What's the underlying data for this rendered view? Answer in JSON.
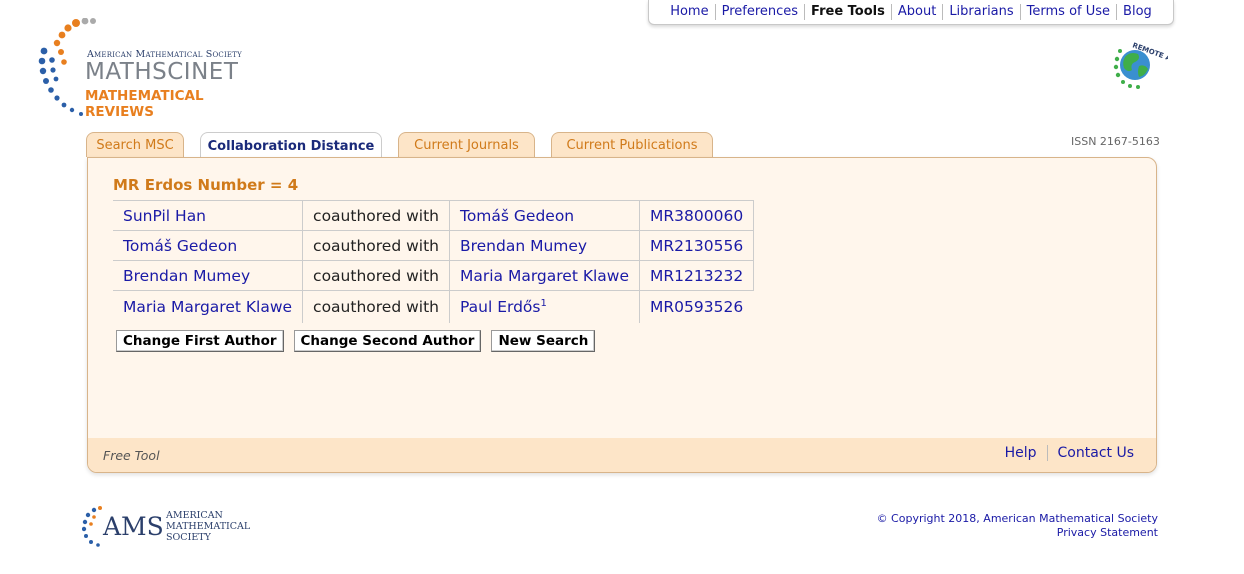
{
  "topnav": [
    "Home",
    "Preferences",
    "Free Tools",
    "About",
    "Librarians",
    "Terms of Use",
    "Blog"
  ],
  "topnav_active": "Free Tools",
  "logo": {
    "line1": "American Mathematical Society",
    "line2": "MATHSCINET",
    "line3": "MATHEMATICAL REVIEWS"
  },
  "remote_access": "REMOTE ACCESS",
  "tabs": [
    "Search MSC",
    "Collaboration Distance",
    "Current Journals",
    "Current Publications"
  ],
  "active_tab": "Collaboration Distance",
  "issn": "ISSN 2167-5163",
  "result": {
    "title": "MR Erdos Number = 4",
    "rows": [
      {
        "author1": "SunPil Han",
        "relation": "coauthored with",
        "author2": "Tomáš Gedeon",
        "author2_sup": "",
        "mr": "MR3800060"
      },
      {
        "author1": "Tomáš Gedeon",
        "relation": "coauthored with",
        "author2": "Brendan Mumey",
        "author2_sup": "",
        "mr": "MR2130556"
      },
      {
        "author1": "Brendan Mumey",
        "relation": "coauthored with",
        "author2": "Maria Margaret Klawe",
        "author2_sup": "",
        "mr": "MR1213232"
      },
      {
        "author1": "Maria Margaret Klawe",
        "relation": "coauthored with",
        "author2": "Paul Erdős",
        "author2_sup": "1",
        "mr": "MR0593526"
      }
    ]
  },
  "buttons": {
    "change_first": "Change First Author",
    "change_second": "Change Second Author",
    "new_search": "New Search"
  },
  "footer": {
    "free_tool": "Free Tool",
    "help": "Help",
    "contact": "Contact Us"
  },
  "ams_logo": {
    "big": "AMS",
    "small": [
      "AMERICAN",
      "MATHEMATICAL",
      "SOCIETY"
    ]
  },
  "copyright": "© Copyright 2018, American Mathematical Society",
  "privacy": "Privacy Statement",
  "colors": {
    "accent_orange": "#d07a1a",
    "link_blue": "#1a1aa6",
    "panel_bg": "#fff6ec",
    "tab_bg": "#fde5c8"
  }
}
